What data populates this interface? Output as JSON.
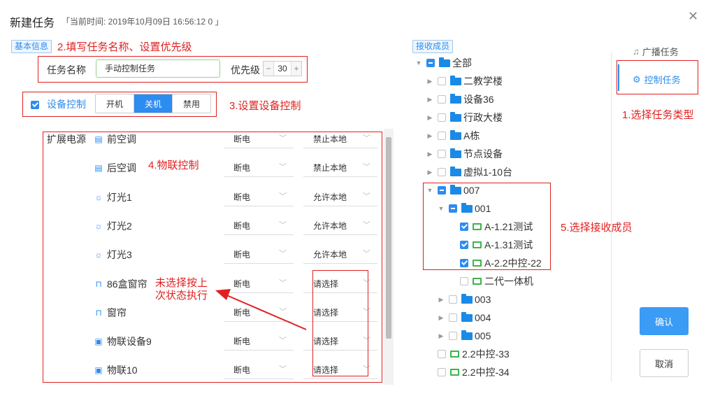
{
  "dialog": {
    "title": "新建任务",
    "current_time": "「当前时间: 2019年10月09日 16:56:12 0 」"
  },
  "basic_info": {
    "tag": "基本信息",
    "task_name_label": "任务名称",
    "task_name_value": "手动控制任务",
    "priority_label": "优先级",
    "priority_value": "30",
    "minus": "−",
    "plus": "+"
  },
  "device_control": {
    "label": "设备控制",
    "checked": true,
    "options": [
      "开机",
      "关机",
      "禁用"
    ],
    "selected": "关机"
  },
  "devices": {
    "group_label": "扩展电源",
    "items": [
      {
        "name": "前空调",
        "icon": "air-conditioner-icon",
        "power": "断电",
        "local": "禁止本地"
      },
      {
        "name": "后空调",
        "icon": "air-conditioner-icon",
        "power": "断电",
        "local": "禁止本地"
      },
      {
        "name": "灯光1",
        "icon": "light-icon",
        "power": "断电",
        "local": "允许本地"
      },
      {
        "name": "灯光2",
        "icon": "light-icon",
        "power": "断电",
        "local": "允许本地"
      },
      {
        "name": "灯光3",
        "icon": "light-icon",
        "power": "断电",
        "local": "允许本地"
      },
      {
        "name": "86盒窗帘",
        "icon": "curtain-icon",
        "power": "断电",
        "local": "请选择"
      },
      {
        "name": "窗帘",
        "icon": "curtain-icon",
        "power": "断电",
        "local": "请选择"
      },
      {
        "name": "物联设备9",
        "icon": "iot-device-icon",
        "power": "断电",
        "local": "请选择"
      },
      {
        "name": "物联10",
        "icon": "iot-device-icon",
        "power": "断电",
        "local": "请选择"
      }
    ]
  },
  "receivers": {
    "tag": "接收成员",
    "tree": [
      {
        "label": "全部",
        "indent": 0,
        "arrow": "▼",
        "check": "half",
        "type": "folder"
      },
      {
        "label": "二教学楼",
        "indent": 1,
        "arrow": "▶",
        "check": "off",
        "type": "folder"
      },
      {
        "label": "设备36",
        "indent": 1,
        "arrow": "▶",
        "check": "off",
        "type": "folder"
      },
      {
        "label": "行政大楼",
        "indent": 1,
        "arrow": "▶",
        "check": "off",
        "type": "folder"
      },
      {
        "label": "A栋",
        "indent": 1,
        "arrow": "▶",
        "check": "off",
        "type": "folder"
      },
      {
        "label": "节点设备",
        "indent": 1,
        "arrow": "▶",
        "check": "off",
        "type": "folder"
      },
      {
        "label": "虚拟1-10台",
        "indent": 1,
        "arrow": "▶",
        "check": "off",
        "type": "folder"
      },
      {
        "label": "007",
        "indent": 1,
        "arrow": "▼",
        "check": "half",
        "type": "folder"
      },
      {
        "label": "001",
        "indent": 2,
        "arrow": "▼",
        "check": "half",
        "type": "folder"
      },
      {
        "label": "A-1.21测试",
        "indent": 3,
        "arrow": "",
        "check": "on",
        "type": "terminal"
      },
      {
        "label": "A-1.31测试",
        "indent": 3,
        "arrow": "",
        "check": "on",
        "type": "terminal"
      },
      {
        "label": "A-2.2中控-22",
        "indent": 3,
        "arrow": "",
        "check": "on",
        "type": "terminal"
      },
      {
        "label": "二代一体机",
        "indent": 3,
        "arrow": "",
        "check": "off",
        "type": "terminal"
      },
      {
        "label": "003",
        "indent": 2,
        "arrow": "▶",
        "check": "off",
        "type": "folder"
      },
      {
        "label": "004",
        "indent": 2,
        "arrow": "▶",
        "check": "off",
        "type": "folder"
      },
      {
        "label": "005",
        "indent": 2,
        "arrow": "▶",
        "check": "off",
        "type": "folder"
      },
      {
        "label": "2.2中控-33",
        "indent": 1,
        "arrow": "",
        "check": "off",
        "type": "terminal"
      },
      {
        "label": "2.2中控-34",
        "indent": 1,
        "arrow": "",
        "check": "off",
        "type": "terminal"
      }
    ]
  },
  "task_types": {
    "broadcast": "广播任务",
    "control": "控制任务",
    "selected": "控制任务"
  },
  "actions": {
    "confirm": "确认",
    "cancel": "取消"
  },
  "annotations": {
    "a1": "1.选择任务类型",
    "a2": "2.填写任务名称、设置优先级",
    "a3": "3.设置设备控制",
    "a4": "4.物联控制",
    "a5": "5.选择接收成员",
    "note_line1": "未选择按上",
    "note_line2": "次状态执行"
  },
  "colors": {
    "accent": "#2d8cf0",
    "annotation": "#e02020",
    "terminal": "#3cb34a"
  }
}
